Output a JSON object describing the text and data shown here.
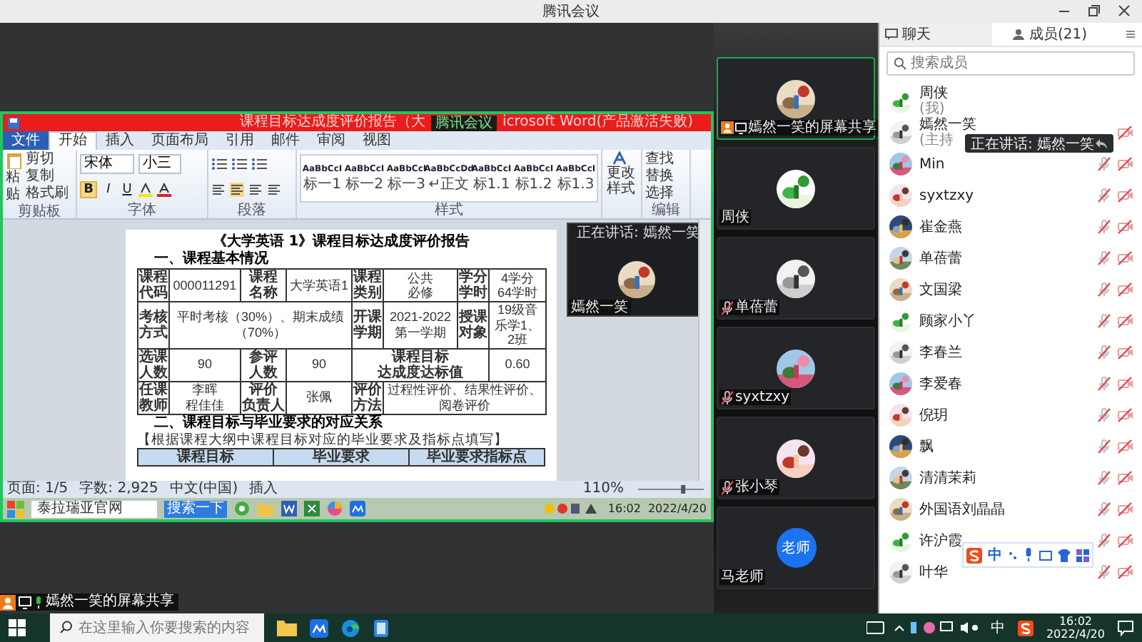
{
  "window": {
    "title": "腾讯会议"
  },
  "word": {
    "title_start": "课程目标达成度评价报告（大",
    "title_end": "icrosoft Word(产品激活失败)",
    "share_tag": "腾讯会议",
    "tabs": [
      {
        "label": "文件",
        "kind": "file",
        "selected": false
      },
      {
        "label": "开始",
        "kind": "tab",
        "selected": true
      },
      {
        "label": "插入",
        "kind": "tab",
        "selected": false
      },
      {
        "label": "页面布局",
        "kind": "tab",
        "selected": false
      },
      {
        "label": "引用",
        "kind": "tab",
        "selected": false
      },
      {
        "label": "邮件",
        "kind": "tab",
        "selected": false
      },
      {
        "label": "审阅",
        "kind": "tab",
        "selected": false
      },
      {
        "label": "视图",
        "kind": "tab",
        "selected": false
      }
    ],
    "clipboard": {
      "paste": "粘贴",
      "items": [
        "剪切",
        "复制",
        "格式刷"
      ],
      "group": "剪贴板"
    },
    "font": {
      "name": "宋体",
      "size": "小三",
      "buttons": [
        "B",
        "I",
        "U"
      ],
      "group": "字体"
    },
    "paragraph": {
      "group": "段落"
    },
    "styles": {
      "group": "样式",
      "items": [
        {
          "sample": "AaBbCcI",
          "label": "标一1"
        },
        {
          "sample": "AaBbCcI",
          "label": "标一2"
        },
        {
          "sample": "AaBbCcI",
          "label": "标一3"
        },
        {
          "sample": "AaBbCcDd",
          "label": "↵正文"
        },
        {
          "sample": "AaBbCcI",
          "label": "标1.1"
        },
        {
          "sample": "AaBbCcI",
          "label": "标1.2"
        },
        {
          "sample": "AaBbCcI",
          "label": "标1.3"
        }
      ]
    },
    "change_styles": "更改样式",
    "editing": {
      "group": "编辑",
      "items": [
        "查找",
        "替换",
        "选择"
      ]
    },
    "document": {
      "title": "《大学英语 1》课程目标达成度评价报告",
      "section1": "一、课程基本情况",
      "section2": "二、课程目标与毕业要求的对应关系",
      "note": "【根据课程大纲中课程目标对应的毕业要求及指标点填写】",
      "table1": [
        [
          {
            "kind": "label",
            "lines": [
              "课程",
              "代码"
            ]
          },
          {
            "kind": "value",
            "lines": [
              "000011291"
            ]
          },
          {
            "kind": "label",
            "lines": [
              "课程",
              "名称"
            ]
          },
          {
            "kind": "value",
            "lines": [
              "大学英语1"
            ]
          },
          {
            "kind": "label",
            "lines": [
              "课程",
              "类别"
            ]
          },
          {
            "kind": "value",
            "lines": [
              "公共",
              "必修"
            ]
          },
          {
            "kind": "label",
            "lines": [
              "学分",
              "学时"
            ]
          },
          {
            "kind": "value",
            "lines": [
              "4学分",
              "64学时"
            ]
          }
        ],
        [
          {
            "kind": "label",
            "lines": [
              "考核",
              "方式"
            ]
          },
          {
            "kind": "value",
            "lines": [
              "平时考核（30%）、期末成绩（70%）"
            ]
          },
          {
            "kind": "label",
            "lines": [
              "开课",
              "学期"
            ]
          },
          {
            "kind": "value",
            "lines": [
              "2021-2022",
              "第一学期"
            ]
          },
          {
            "kind": "label",
            "lines": [
              "授课",
              "对象"
            ]
          },
          {
            "kind": "value",
            "lines": [
              "19级音乐学1、2班"
            ]
          }
        ],
        [
          {
            "kind": "label",
            "lines": [
              "选课",
              "人数"
            ]
          },
          {
            "kind": "value",
            "lines": [
              "90"
            ]
          },
          {
            "kind": "label",
            "lines": [
              "参评",
              "人数"
            ]
          },
          {
            "kind": "value",
            "lines": [
              "90"
            ]
          },
          {
            "kind": "label",
            "lines": [
              "课程目标",
              "达成度达标值"
            ]
          },
          {
            "kind": "value",
            "lines": [
              "0.60"
            ]
          }
        ],
        [
          {
            "kind": "label",
            "lines": [
              "任课",
              "教师"
            ]
          },
          {
            "kind": "value",
            "lines": [
              "李晖",
              "程佳佳"
            ]
          },
          {
            "kind": "label",
            "lines": [
              "评价",
              "负责人"
            ]
          },
          {
            "kind": "value",
            "lines": [
              "张佩"
            ]
          },
          {
            "kind": "label",
            "lines": [
              "评价",
              "方法"
            ]
          },
          {
            "kind": "value",
            "lines": [
              "过程性评价、结果性评价、阅卷评价"
            ]
          }
        ]
      ],
      "table2_header": [
        "课程目标",
        "毕业要求",
        "毕业要求指标点"
      ]
    },
    "speaker": {
      "status": "正在讲话: 嫣然一笑",
      "name": "嫣然一笑"
    },
    "status_bar": {
      "items": [
        "页面: 1/5",
        "字数: 2,925",
        "中文(中国)",
        "插入"
      ],
      "zoom": "110%",
      "zoom_slider": {
        "level": 0.7
      }
    },
    "xp_taskbar": {
      "search": "泰拉瑞亚官网",
      "search_button": "搜索一下",
      "time": "16:02",
      "date": "2022/4/20"
    }
  },
  "stage": {
    "share_label": "嫣然一笑的屏幕共享"
  },
  "videos": [
    {
      "kind": "share",
      "name": "嫣然一笑的屏幕共享",
      "mic_off": false,
      "speaking": true
    },
    {
      "kind": "person",
      "name": "周侠",
      "mic_off": false,
      "speaking": false
    },
    {
      "kind": "person",
      "name": "单蓓蕾",
      "mic_off": true,
      "speaking": false
    },
    {
      "kind": "person",
      "name": "syxtzxy",
      "mic_off": true,
      "speaking": false
    },
    {
      "kind": "person",
      "name": "张小琴",
      "mic_off": true,
      "speaking": false
    },
    {
      "kind": "text_avatar",
      "avatar_text": "老师",
      "name": "马老师",
      "mic_off": false,
      "speaking": false
    }
  ],
  "panel": {
    "tabs": [
      {
        "label": "聊天",
        "selected": false
      },
      {
        "label": "成员(21)",
        "selected": true
      }
    ],
    "search_placeholder": "搜索成员",
    "members": [
      {
        "name": "周侠",
        "sub": "(我)",
        "mic_off": false,
        "camera_off": false
      },
      {
        "name": "嫣然一笑",
        "sub": "(主持",
        "mic_off": false,
        "camera_off": true
      },
      {
        "name": "Min",
        "mic_off": true,
        "camera_off": true
      },
      {
        "name": "syxtzxy",
        "mic_off": true,
        "camera_off": true
      },
      {
        "name": "崔金燕",
        "mic_off": true,
        "camera_off": true
      },
      {
        "name": "单蓓蕾",
        "mic_off": true,
        "camera_off": true
      },
      {
        "name": "文国梁",
        "mic_off": true,
        "camera_off": true
      },
      {
        "name": "顾家小丫",
        "mic_off": true,
        "camera_off": true
      },
      {
        "name": "李春兰",
        "mic_off": true,
        "camera_off": true
      },
      {
        "name": "李爱春",
        "mic_off": true,
        "camera_off": true
      },
      {
        "name": "倪玥",
        "mic_off": true,
        "camera_off": true
      },
      {
        "name": "飘",
        "mic_off": true,
        "camera_off": true
      },
      {
        "name": "清清茉莉",
        "mic_off": true,
        "camera_off": true
      },
      {
        "name": "外国语刘晶晶",
        "mic_off": true,
        "camera_off": true
      },
      {
        "name": "许沪霞",
        "mic_off": true,
        "camera_off": true
      },
      {
        "name": "叶华",
        "mic_off": true,
        "camera_off": true
      }
    ],
    "speaking_tip": "正在讲话: 嫣然一笑",
    "ime_mode": "中"
  },
  "taskbar": {
    "search_placeholder": "在这里输入你要搜索的内容",
    "ime": "中",
    "time": "16:02",
    "date": "2022/4/20"
  }
}
